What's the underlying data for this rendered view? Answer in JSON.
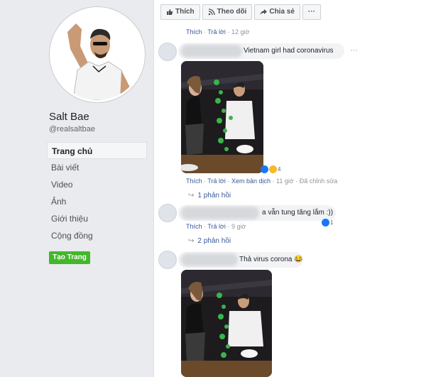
{
  "sidebar": {
    "page_name": "Salt Bae",
    "handle": "@realsaltbae",
    "nav": [
      "Trang chủ",
      "Bài viết",
      "Video",
      "Ảnh",
      "Giới thiệu",
      "Cộng đồng"
    ],
    "create_page": "Tạo Trang"
  },
  "actions": {
    "like": "Thích",
    "follow": "Theo dõi",
    "share": "Chia sẻ",
    "more": "···"
  },
  "comments": [
    {
      "meta": {
        "like": "Thích",
        "reply": "Trả lời",
        "time": "12 giờ"
      }
    },
    {
      "text": "Vietnam girl had coronavirus",
      "meta": {
        "like": "Thích",
        "reply": "Trả lời",
        "translate": "Xem bản dịch",
        "time": "11 giờ",
        "edited": "Đã chỉnh sửa"
      },
      "reaction_count": "4",
      "replies": "1 phản hồi"
    },
    {
      "text": "a vẫn tung tăng lắm :))",
      "meta": {
        "like": "Thích",
        "reply": "Trả lời",
        "time": "9 giờ"
      },
      "reaction_count": "1",
      "replies": "2 phản hồi"
    },
    {
      "text": "Thả virus corona 😂"
    }
  ],
  "colors": {
    "link": "#385898",
    "green": "#42b72a",
    "bg": "#e9ebee"
  }
}
